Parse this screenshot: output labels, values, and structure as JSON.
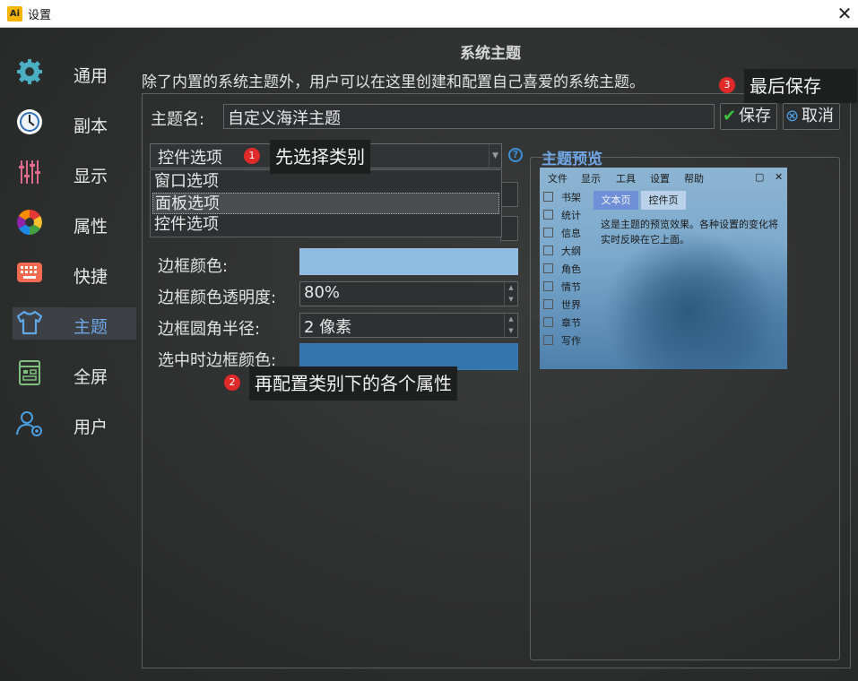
{
  "window": {
    "title": "设置",
    "app_icon_text": "Ai"
  },
  "sidebar": {
    "items": [
      {
        "label": "通用",
        "icon": "gear-icon",
        "active": false
      },
      {
        "label": "副本",
        "icon": "clock-icon",
        "active": false
      },
      {
        "label": "显示",
        "icon": "sliders-icon",
        "active": false
      },
      {
        "label": "属性",
        "icon": "palette-icon",
        "active": false
      },
      {
        "label": "快捷",
        "icon": "keyboard-icon",
        "active": false
      },
      {
        "label": "主题",
        "icon": "shirt-icon",
        "active": true
      },
      {
        "label": "全屏",
        "icon": "fullscreen-icon",
        "active": false
      },
      {
        "label": "用户",
        "icon": "user-settings-icon",
        "active": false
      }
    ]
  },
  "main": {
    "heading": "系统主题",
    "description": "除了内置的系统主题外，用户可以在这里创建和配置自己喜爱的系统主题。",
    "theme_name_label": "主题名:",
    "theme_name_value": "自定义海洋主题",
    "save_label": "保存",
    "cancel_label": "取消",
    "category": {
      "selected": "控件选项",
      "options": [
        "窗口选项",
        "面板选项",
        "控件选项"
      ],
      "highlighted_index": 1
    },
    "properties": [
      {
        "label": "边框颜色:",
        "type": "color",
        "color": "#8dbbe2"
      },
      {
        "label": "边框颜色透明度:",
        "type": "spin",
        "value": "80%"
      },
      {
        "label": "边框圆角半径:",
        "type": "spin",
        "value": "2 像素"
      },
      {
        "label": "选中时边框颜色:",
        "type": "color",
        "color": "#3475b0"
      }
    ]
  },
  "callouts": [
    {
      "num": "1",
      "text": "先选择类别"
    },
    {
      "num": "2",
      "text": "再配置类别下的各个属性"
    },
    {
      "num": "3",
      "text": "最后保存"
    }
  ],
  "preview": {
    "title": "主题预览",
    "menu": [
      "文件",
      "显示",
      "工具",
      "设置",
      "帮助"
    ],
    "side_items": [
      "书架",
      "统计",
      "信息",
      "大纲",
      "角色",
      "情节",
      "世界",
      "章节",
      "写作"
    ],
    "tabs": [
      {
        "label": "文本页",
        "active": true
      },
      {
        "label": "控件页",
        "active": false
      }
    ],
    "text": "这是主题的预览效果。各种设置的变化将实时反映在它上面。"
  }
}
